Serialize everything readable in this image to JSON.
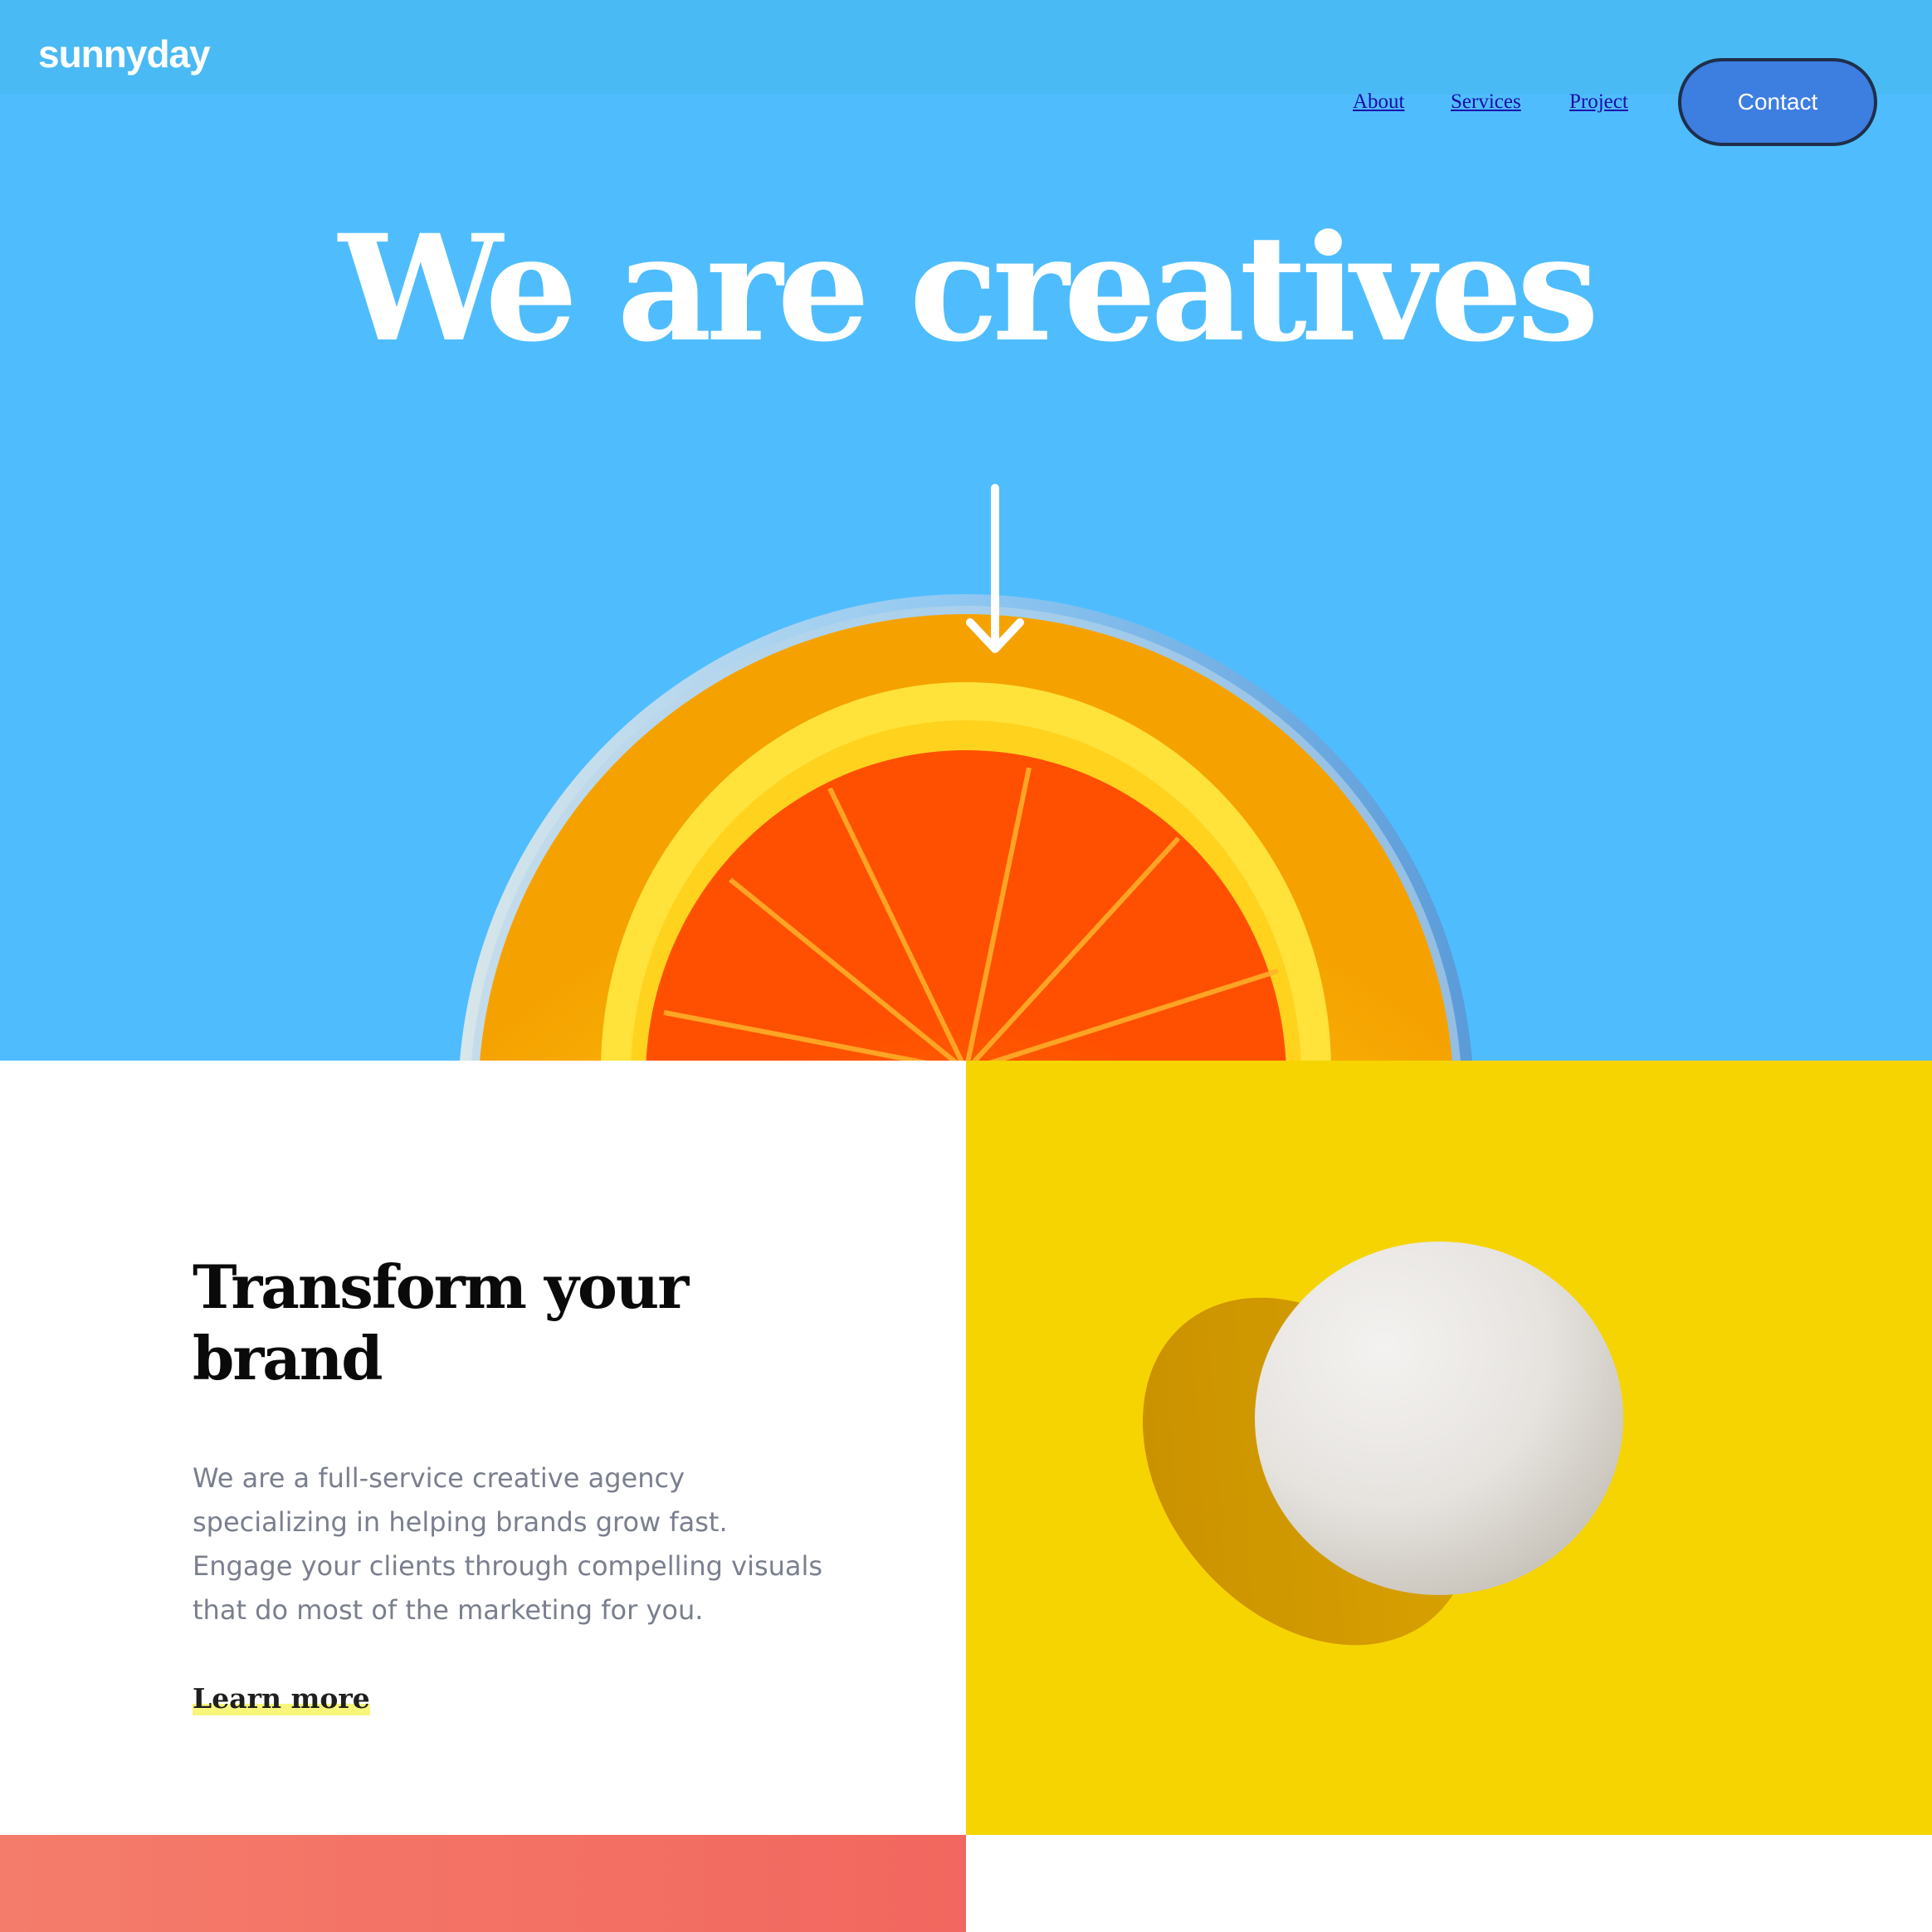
{
  "brand": {
    "logo": "sunnyday"
  },
  "nav": {
    "items": [
      {
        "label": "About"
      },
      {
        "label": "Services"
      },
      {
        "label": "Project"
      }
    ],
    "contact_label": "Contact"
  },
  "hero": {
    "title": "We are creatives",
    "arrow_icon": "arrow-down-icon",
    "image": "orange-juice-glass-top-view"
  },
  "feature": {
    "heading": "Transform your brand",
    "body": "We are a full-service creative agency specializing in helping brands grow fast. Engage your clients through compelling visuals that do most of the marketing for you.",
    "cta": "Learn more",
    "image": "egg-on-yellow-background"
  },
  "colors": {
    "hero_background": "#4fbdfd",
    "topbar_background": "#4abaf4",
    "contact_button": "#3d7ee1",
    "egg_panel": "#f6d402",
    "coral_panel": "#f47c6b",
    "link_highlight": "#f7f57a",
    "nav_link": "#1a0dab"
  }
}
